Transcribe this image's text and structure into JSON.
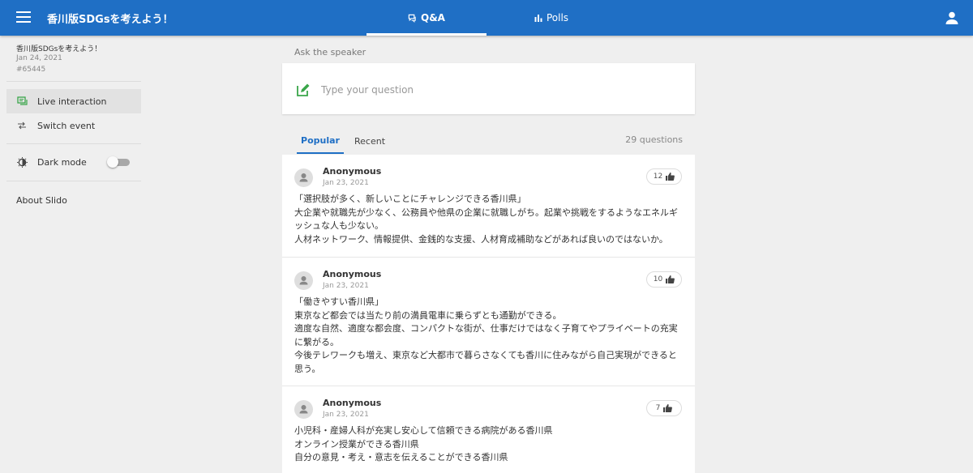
{
  "header": {
    "event_title": "香川版SDGsを考えよう！",
    "tabs": [
      {
        "label": "Q&A",
        "icon": "chat-bubble-icon",
        "active": true
      },
      {
        "label": "Polls",
        "icon": "bar-chart-icon",
        "active": false
      }
    ],
    "user_icon": "person-icon",
    "menu_icon": "hamburger-menu-icon",
    "brand_color": "#1f6fc5"
  },
  "sidebar": {
    "event_name": "香川版SDGsを考えよう！",
    "event_date": "Jan 24, 2021",
    "event_code": "#65445",
    "items": [
      {
        "label": "Live interaction",
        "icon": "live-chat-icon",
        "active": true
      },
      {
        "label": "Switch event",
        "icon": "swap-arrows-icon",
        "active": false
      }
    ],
    "dark_mode": {
      "label": "Dark mode",
      "icon": "contrast-icon",
      "enabled": false
    },
    "about": "About Slido"
  },
  "ask": {
    "label": "Ask the speaker",
    "placeholder": "Type your question",
    "icon": "pencil-square-icon",
    "icon_color": "#3aa64a"
  },
  "list": {
    "tabs": [
      {
        "label": "Popular",
        "active": true
      },
      {
        "label": "Recent",
        "active": false
      }
    ],
    "count": "29 questions"
  },
  "questions": [
    {
      "author": "Anonymous",
      "date": "Jan 23, 2021",
      "likes": "12",
      "lines": [
        "「選択肢が多く、新しいことにチャレンジできる香川県」",
        "大企業や就職先が少なく、公務員や他県の企業に就職しがち。起業や挑戦をするようなエネルギ",
        "ッシュな人も少ない。",
        "人材ネットワーク、情報提供、金銭的な支援、人材育成補助などがあれば良いのではないか。"
      ]
    },
    {
      "author": "Anonymous",
      "date": "Jan 23, 2021",
      "likes": "10",
      "lines": [
        "「働きやすい香川県」",
        "東京など都会では当たり前の満員電車に乗らずとも通勤ができる。",
        "適度な自然、適度な都会度、コンパクトな街が、仕事だけではなく子育てやプライベートの充実",
        "に繋がる。",
        "今後テレワークも増え、東京など大都市で暮らさなくても香川に住みながら自己実現ができると",
        "思う。"
      ]
    },
    {
      "author": "Anonymous",
      "date": "Jan 23, 2021",
      "likes": "7",
      "lines": [
        "小児科・産婦人科が充実し安心して信頼できる病院がある香川県",
        "オンライン授業ができる香川県",
        "自分の意見・考え・意志を伝えることができる香川県"
      ]
    }
  ]
}
